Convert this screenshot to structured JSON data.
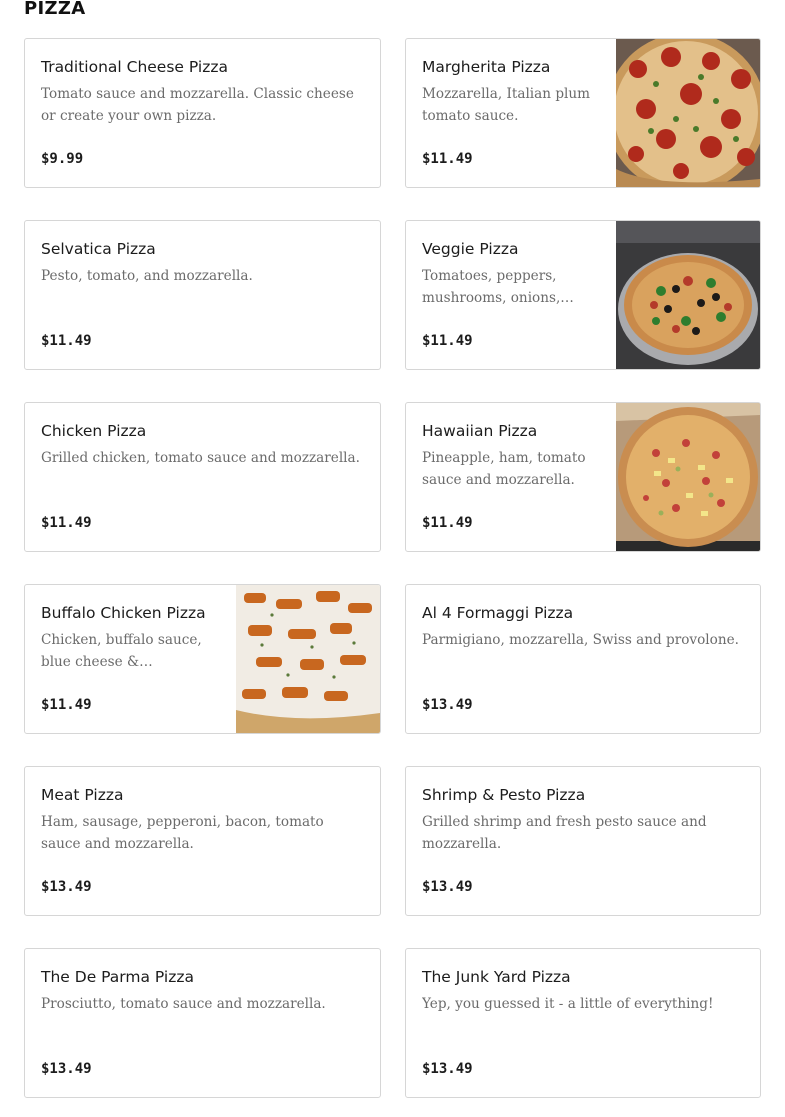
{
  "section": {
    "title": "PIZZA"
  },
  "items": [
    {
      "name": "Traditional Cheese Pizza",
      "description": "Tomato sauce and mozzarella. Classic cheese or create your own pizza.",
      "price": "$9.99"
    },
    {
      "name": "Margherita Pizza",
      "description": "Mozzarella, Italian plum tomato sauce.",
      "price": "$11.49",
      "photo": "margherita-pizza-photo"
    },
    {
      "name": "Selvatica Pizza",
      "description": "Pesto, tomato, and mozzarella.",
      "price": "$11.49"
    },
    {
      "name": "Veggie Pizza",
      "description": "Tomatoes, peppers, mushrooms, onions, olive…",
      "price": "$11.49",
      "photo": "veggie-pizza-photo"
    },
    {
      "name": "Chicken Pizza",
      "description": "Grilled chicken, tomato sauce and mozzarella.",
      "price": "$11.49"
    },
    {
      "name": "Hawaiian Pizza",
      "description": "Pineapple, ham, tomato sauce and mozzarella.",
      "price": "$11.49",
      "photo": "hawaiian-pizza-photo"
    },
    {
      "name": "Buffalo Chicken Pizza",
      "description": "Chicken, buffalo sauce, blue cheese & mozzarella.",
      "price": "$11.49",
      "photo": "buffalo-chicken-pizza-photo"
    },
    {
      "name": "Al 4 Formaggi Pizza",
      "description": "Parmigiano, mozzarella, Swiss and provolone.",
      "price": "$13.49"
    },
    {
      "name": "Meat Pizza",
      "description": "Ham, sausage, pepperoni, bacon, tomato sauce and mozzarella.",
      "price": "$13.49"
    },
    {
      "name": "Shrimp & Pesto Pizza",
      "description": "Grilled shrimp and fresh pesto sauce and mozzarella.",
      "price": "$13.49"
    },
    {
      "name": "The De Parma Pizza",
      "description": "Prosciutto, tomato sauce and mozzarella.",
      "price": "$13.49"
    },
    {
      "name": "The Junk Yard Pizza",
      "description": "Yep, you guessed it - a little of everything!",
      "price": "$13.49"
    }
  ]
}
